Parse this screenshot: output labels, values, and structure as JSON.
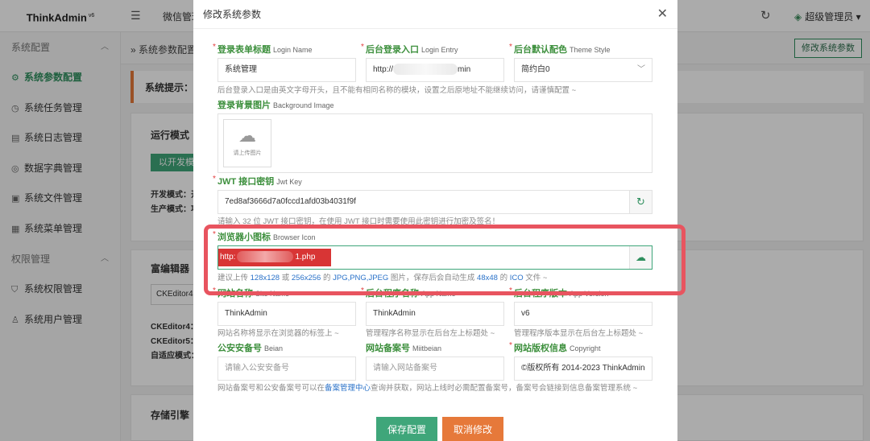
{
  "app": {
    "brand": "ThinkAdmin",
    "brand_version": "v6",
    "top_nav_label": "微信管理",
    "user_label": "超级管理员"
  },
  "sidebar": {
    "groups": [
      {
        "label": "系统配置",
        "items": [
          {
            "label": "系统参数配置",
            "icon": "gear-icon",
            "active": true
          },
          {
            "label": "系统任务管理",
            "icon": "clock-icon"
          },
          {
            "label": "系统日志管理",
            "icon": "doc-icon"
          },
          {
            "label": "数据字典管理",
            "icon": "dict-icon"
          },
          {
            "label": "系统文件管理",
            "icon": "file-icon"
          },
          {
            "label": "系统菜单管理",
            "icon": "menu-icon"
          }
        ]
      },
      {
        "label": "权限管理",
        "items": [
          {
            "label": "系统权限管理",
            "icon": "shield-icon"
          },
          {
            "label": "系统用户管理",
            "icon": "user-icon"
          }
        ]
      }
    ]
  },
  "content": {
    "breadcrumb": "» 系统参数配置",
    "edit_button": "修改系统参数",
    "tip": "系统提示：",
    "card1": {
      "title": "运行模式",
      "button": "以开发模式",
      "line1": "开发模式：开",
      "line2": "生产模式：项"
    },
    "card2": {
      "title": "富编辑器",
      "select": "CKEditor4",
      "line1": "CKEditor4：",
      "line2": "CKEditor5：",
      "line3": "自适应模式："
    },
    "card3": {
      "title": "存储引擎"
    }
  },
  "modal": {
    "title": "修改系统参数",
    "fields": {
      "login_name": {
        "label": "登录表单标题",
        "en": "Login Name",
        "value": "系统管理"
      },
      "login_entry": {
        "label": "后台登录入口",
        "en": "Login Entry",
        "value_prefix": "http://",
        "value_suffix": "min"
      },
      "theme_style": {
        "label": "后台默认配色",
        "en": "Theme Style",
        "value": "简约白0"
      },
      "entry_help": "后台登录入口是由英文字母开头，且不能有相同名称的模块，设置之后原地址不能继续访问，请谨慎配置 ~",
      "bg_image": {
        "label": "登录背景图片",
        "en": "Background Image",
        "upload_text": "请上传图片"
      },
      "jwt_key": {
        "label": "JWT 接口密钥",
        "en": "Jwt Key",
        "value": "7ed8af3666d7a0fccd1afd03b4031f9f"
      },
      "jwt_help": "请输入 32 位 JWT 接口密钥，在使用 JWT 接口时需要使用此密钥进行加密及签名！",
      "browser_icon": {
        "label": "浏览器小图标",
        "en": "Browser Icon",
        "value_prefix": "http:",
        "value_suffix": "1.php"
      },
      "icon_help_parts": [
        "建议上传 ",
        "128x128",
        " 或 ",
        "256x256",
        " 的 ",
        "JPG,PNG,JPEG",
        " 图片，保存后会自动生成 ",
        "48x48",
        " 的 ",
        "ICO",
        " 文件 ~"
      ],
      "site_name": {
        "label": "网站名称",
        "en": "Site Name",
        "value": "ThinkAdmin",
        "help": "网站名称将显示在浏览器的标签上 ~"
      },
      "app_name": {
        "label": "后台程序名称",
        "en": "App Name",
        "value": "ThinkAdmin",
        "help": "管理程序名称显示在后台左上标题处 ~"
      },
      "app_version": {
        "label": "后台程序版本",
        "en": "App Version",
        "value": "v6",
        "help": "管理程序版本显示在后台左上标题处 ~"
      },
      "beian": {
        "label": "公安安备号",
        "en": "Beian",
        "placeholder": "请输入公安安备号"
      },
      "miitbeian": {
        "label": "网站备案号",
        "en": "Miitbeian",
        "placeholder": "请输入网站备案号"
      },
      "copyright": {
        "label": "网站版权信息",
        "en": "Copyright",
        "value": "©版权所有 2014-2023 ThinkAdmin"
      },
      "beian_help_parts": [
        "网站备案号和公安备案号可以在",
        "备案管理中心",
        "查询并获取，网站上线时必需配置备案号，备案号会链接到信息备案管理系统 ~"
      ]
    },
    "buttons": {
      "save": "保存配置",
      "cancel": "取消修改"
    }
  },
  "colors": {
    "accent": "#3fa67a",
    "label": "#3c8f3c",
    "required": "#e23d3d",
    "highlight": "#e8545f",
    "cancel": "#e6793a"
  }
}
